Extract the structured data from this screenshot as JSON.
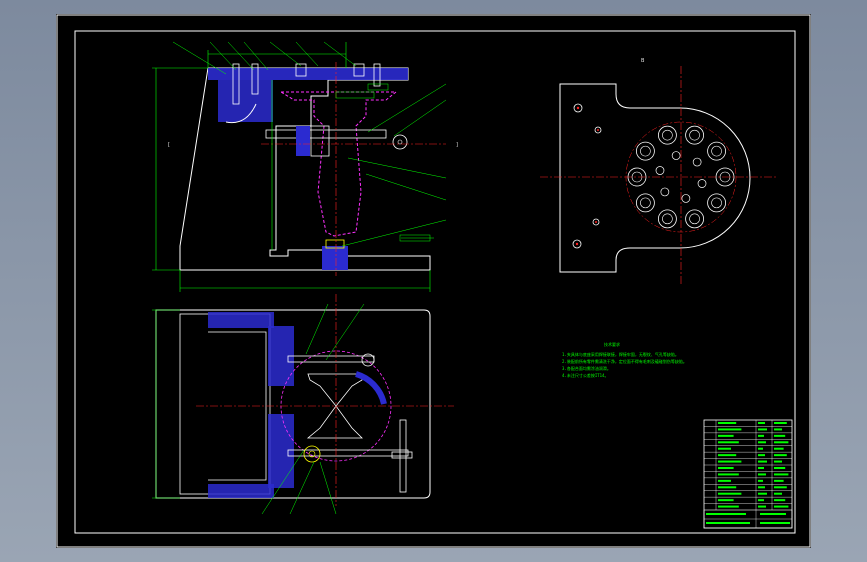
{
  "drawing": {
    "background_color": "#000000",
    "viewport_color": "#8a96a8",
    "colors": {
      "outline": "#ffffff",
      "center_line": "#ff2020",
      "hatch": "#2b2bd0",
      "dimension": "#00ff00",
      "hidden": "#ff30ff",
      "accent": "#ffff00"
    },
    "detail_view_label": "B",
    "section_label_left": "[",
    "section_label_right": "]"
  },
  "technical_requirements": {
    "title": "技术要求",
    "lines": [
      "1.夹具体与底座采用焊接联接，焊接牢固，无裂纹、气孔等缺陷。",
      "2.装配前所有零件需清洗干净，定位面不得有毛刺及磕碰划伤等缺陷。",
      "3.各配合面均需涂油润滑。",
      "4.未注尺寸公差按IT14。"
    ]
  },
  "title_block": {
    "rows": 14
  }
}
